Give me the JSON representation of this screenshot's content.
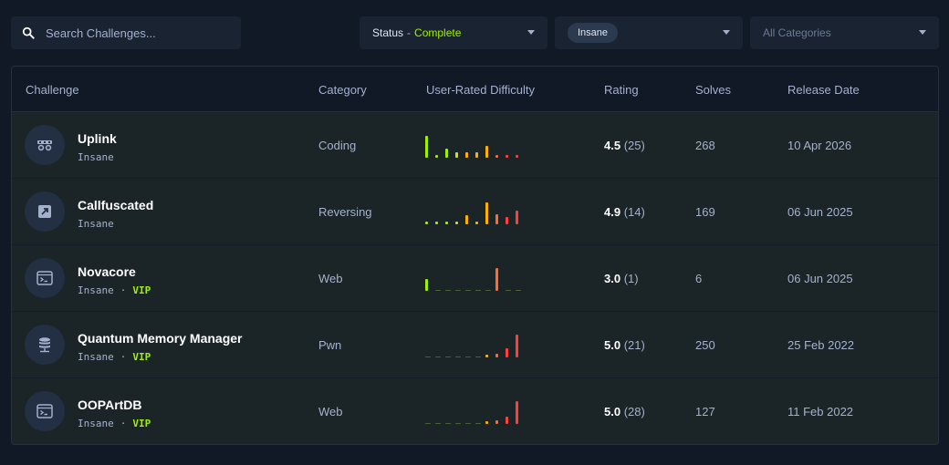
{
  "search": {
    "placeholder": "Search Challenges..."
  },
  "filters": {
    "status_label": "Status",
    "status_sep": "-",
    "status_value": "Complete",
    "difficulty_value": "Insane",
    "category_placeholder": "All Categories"
  },
  "columns": {
    "challenge": "Challenge",
    "category": "Category",
    "difficulty": "User-Rated Difficulty",
    "rating": "Rating",
    "solves": "Solves",
    "release": "Release Date"
  },
  "colors": {
    "accent_green": "#9fef00",
    "bar_scale": [
      "#9fef00",
      "#9fef00",
      "#9fef00",
      "#cfe300",
      "#ffaf00",
      "#ffaf00",
      "#ffaf00",
      "#ff6a33",
      "#ff3e3e",
      "#ff3e3e"
    ]
  },
  "rows": [
    {
      "name": "Uplink",
      "difficulty": "Insane",
      "vip": "",
      "category": "Coding",
      "rating": "4.5",
      "votes": "(25)",
      "solves": "268",
      "release": "10 Apr 2026",
      "icon": "coding-icon",
      "distribution": [
        0.85,
        0.08,
        0.35,
        0.2,
        0.2,
        0.2,
        0.45,
        0.08,
        0.08,
        0.08
      ]
    },
    {
      "name": "Callfuscated",
      "difficulty": "Insane",
      "vip": "",
      "category": "Reversing",
      "rating": "4.9",
      "votes": "(14)",
      "solves": "169",
      "release": "06 Jun 2025",
      "icon": "reversing-icon",
      "distribution": [
        0.12,
        0.05,
        0.05,
        0.12,
        0.35,
        0.05,
        0.85,
        0.4,
        0.3,
        0.55
      ]
    },
    {
      "name": "Novacore",
      "difficulty": "Insane",
      "vip": "VIP",
      "category": "Web",
      "rating": "3.0",
      "votes": "(1)",
      "solves": "6",
      "release": "06 Jun 2025",
      "icon": "terminal-window-icon",
      "distribution": [
        0.45,
        0,
        0,
        0,
        0,
        0,
        0,
        0.9,
        0,
        0
      ]
    },
    {
      "name": "Quantum Memory Manager",
      "difficulty": "Insane",
      "vip": "VIP",
      "category": "Pwn",
      "rating": "5.0",
      "votes": "(21)",
      "solves": "250",
      "release": "25 Feb 2022",
      "icon": "database-icon",
      "distribution": [
        0,
        0,
        0,
        0,
        0,
        0,
        0.05,
        0.15,
        0.35,
        0.9
      ]
    },
    {
      "name": "OOPArtDB",
      "difficulty": "Insane",
      "vip": "VIP",
      "category": "Web",
      "rating": "5.0",
      "votes": "(28)",
      "solves": "127",
      "release": "11 Feb 2022",
      "icon": "terminal-window-icon",
      "distribution": [
        0,
        0,
        0,
        0,
        0,
        0,
        0.08,
        0.15,
        0.3,
        0.9
      ]
    }
  ]
}
